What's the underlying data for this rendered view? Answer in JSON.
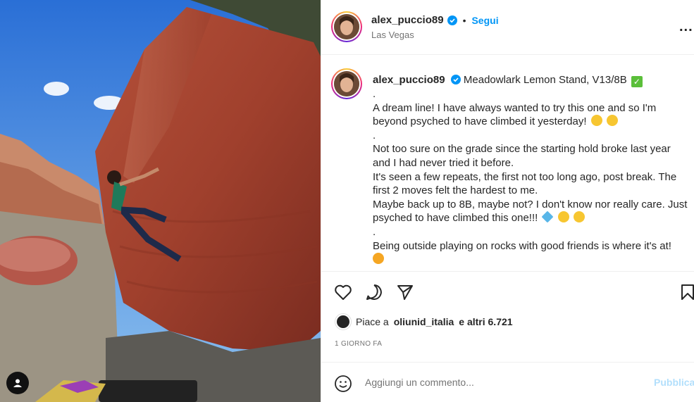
{
  "post": {
    "username": "alex_puccio89",
    "location": "Las Vegas",
    "follow_label": "Segui",
    "dot": "•",
    "more": "..."
  },
  "caption": {
    "username": "alex_puccio89",
    "lines": [
      "Meadowlark Lemon Stand, V13/8B",
      ".",
      "A dream line! I have always wanted to try this one and so I'm",
      "beyond psyched to have climbed it yesterday!",
      ".",
      "Not too sure on the grade since the starting hold broke last year",
      "and I had never tried it before.",
      "It's seen a few repeats, the first not too long ago, post break. The",
      "first 2 moves felt the hardest to me.",
      "Maybe back up to 8B, maybe not? I don't know nor really care. Just",
      "psyched to have climbed this one!!!",
      ".",
      "Being outside playing on rocks with good friends is where it's at!"
    ]
  },
  "likes": {
    "prefix": "Piace a",
    "user": "oliunid_italia",
    "suffix": "e altri 6.721"
  },
  "time_ago": "1 GIORNO FA",
  "comment": {
    "placeholder": "Aggiungi un commento...",
    "publish_label": "Pubblica"
  },
  "colors": {
    "accent": "#0095f6",
    "publish_disabled": "#b2dffc",
    "secondary_text": "#737373"
  },
  "icons": [
    "verified-icon",
    "more-icon",
    "heart-icon",
    "comment-icon",
    "share-icon",
    "bookmark-icon",
    "emoji-icon",
    "user-tag-icon"
  ]
}
